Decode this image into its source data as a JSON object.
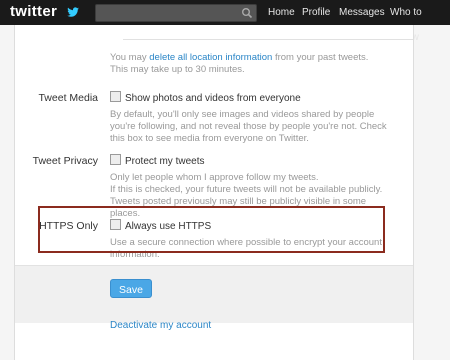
{
  "header": {
    "logo": "twitter",
    "search": {
      "value": "",
      "placeholder": ""
    },
    "nav": [
      "Home",
      "Profile",
      "Messages",
      "Who to Follow"
    ]
  },
  "location": {
    "text_before": "You may ",
    "link": "delete all location information",
    "text_after": " from your past tweets.",
    "note": "This may take up to 30 minutes."
  },
  "tweet_media": {
    "label": "Tweet Media",
    "checkbox_label": "Show photos and videos from everyone",
    "description": "By default, you'll only see images and videos shared by people you're following, and not reveal those by people you're not. Check this box to see media from everyone on Twitter."
  },
  "tweet_privacy": {
    "label": "Tweet Privacy",
    "checkbox_label": "Protect my tweets",
    "description_line1": "Only let people whom I approve follow my tweets.",
    "description_line2": "If this is checked, your future tweets will not be available publicly. Tweets posted previously may still be publicly visible in some places."
  },
  "https_only": {
    "label": "HTTPS Only",
    "checkbox_label": "Always use HTTPS",
    "description": "Use a secure connection where possible to encrypt your account information."
  },
  "actions": {
    "save_label": "Save",
    "deactivate_label": "Deactivate my account"
  },
  "colors": {
    "topbar": "#1a1a1a",
    "link": "#2b86c7",
    "save_button": "#4aa7e6",
    "highlight_border": "#8b2b1e"
  },
  "icons": [
    "twitter-bird-icon",
    "search-icon"
  ]
}
